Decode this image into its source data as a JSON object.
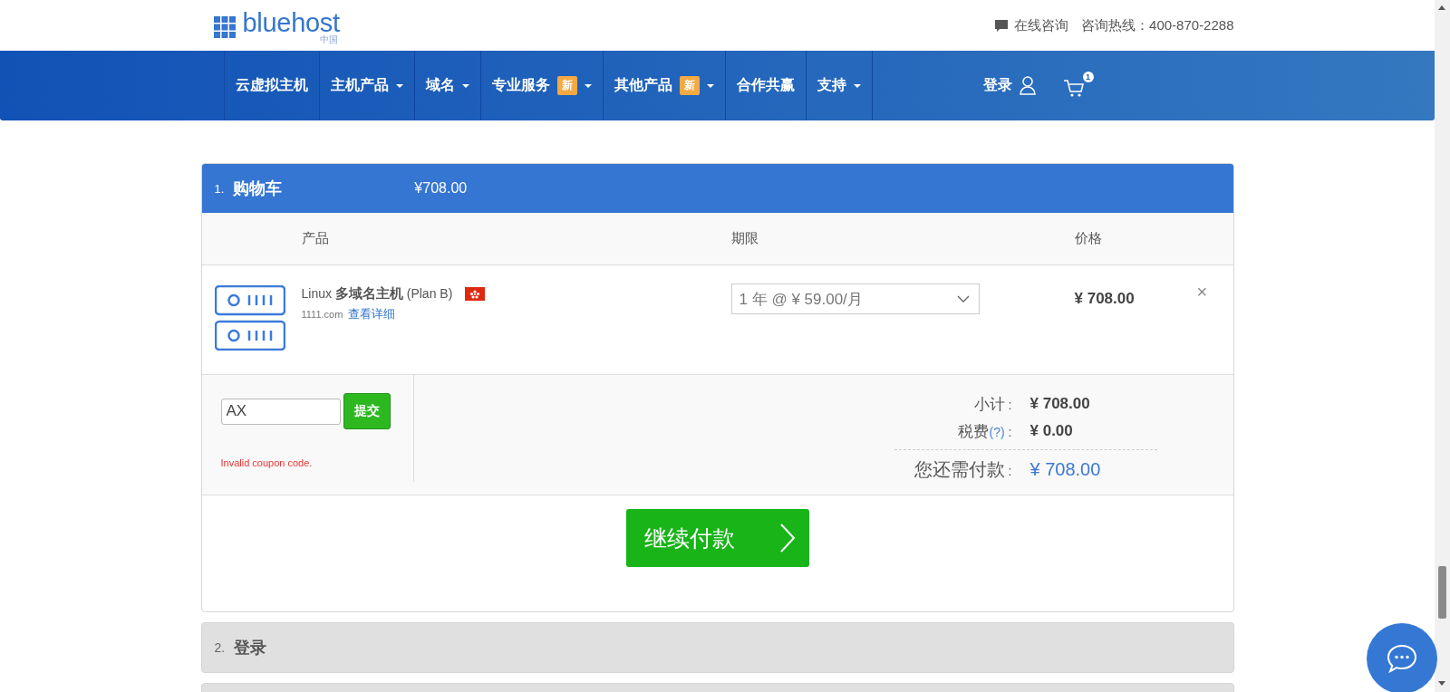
{
  "header": {
    "logo": "bluehost",
    "logo_sub": "中国",
    "chat_link": "在线咨询",
    "hotline_label": "咨询热线：",
    "hotline": "400-870-2288"
  },
  "nav": {
    "items": [
      {
        "label": "云虚拟主机",
        "dropdown": false
      },
      {
        "label": "主机产品",
        "dropdown": true
      },
      {
        "label": "域名",
        "dropdown": true
      },
      {
        "label": "专业服务",
        "badge": "新",
        "dropdown": true
      },
      {
        "label": "其他产品",
        "badge": "新",
        "dropdown": true
      },
      {
        "label": "合作共赢",
        "dropdown": false
      },
      {
        "label": "支持",
        "dropdown": true
      }
    ],
    "login": "登录",
    "cart_count": "1"
  },
  "cart": {
    "step": "1.",
    "title": "购物车",
    "total": "¥708.00",
    "columns": [
      "产品",
      "期限",
      "价格"
    ],
    "items": [
      {
        "os": "Linux",
        "name": "多域名主机",
        "plan": "(Plan B)",
        "domain": "1111.com",
        "details_link": "查看详细",
        "term": "1 年 @ ¥ 59.00/月",
        "price": "¥ 708.00",
        "remove": "×"
      }
    ],
    "coupon": {
      "value": "AX",
      "submit": "提交",
      "error": "Invalid coupon code."
    },
    "summary": [
      {
        "kind": "subtotal",
        "label": "小计",
        "colon": ":",
        "value": "¥ 708.00"
      },
      {
        "kind": "tax",
        "label": "税费",
        "help": "(?)",
        "colon": ":",
        "value": "¥ 0.00"
      },
      {
        "kind": "due",
        "label": "您还需付款",
        "colon": ":",
        "value": "¥ 708.00"
      }
    ],
    "continue": "继续付款"
  },
  "steps": [
    {
      "number": "2.",
      "title": "登录"
    }
  ]
}
